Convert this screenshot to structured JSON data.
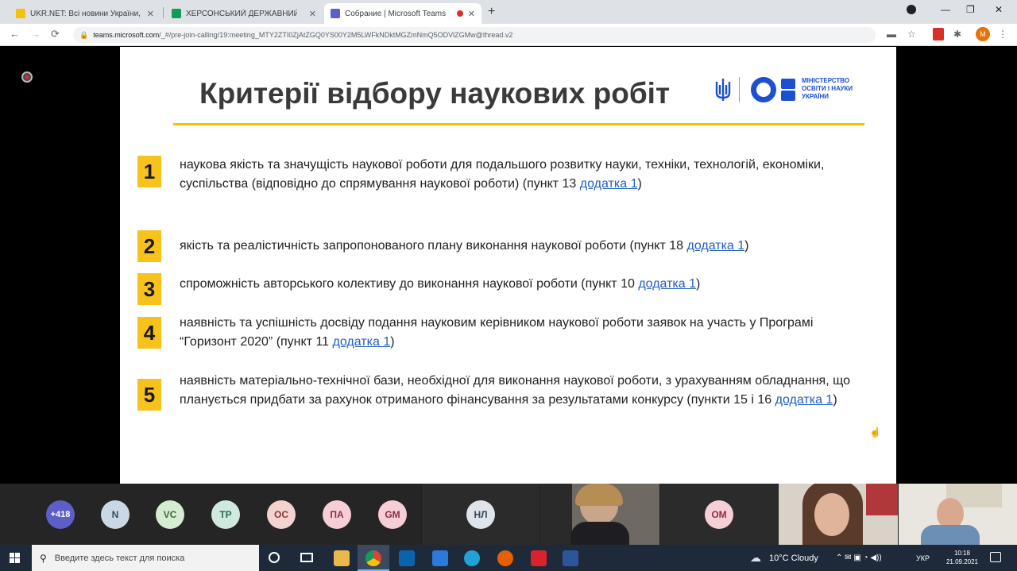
{
  "browser": {
    "tabs": [
      {
        "title": "UKR.NET: Всі новини України, о",
        "active": false,
        "favicon_color": "#f4c20d"
      },
      {
        "title": "ХЕРСОНСЬКИЙ ДЕРЖАВНИЙ А",
        "active": false,
        "favicon_color": "#0f9d58"
      },
      {
        "title": "Собрание | Microsoft Teams",
        "active": true,
        "favicon_color": "#5b5fc7"
      }
    ],
    "new_tab_label": "+",
    "url_host": "teams.microsoft.com",
    "url_path": "/_#/pre-join-calling/19:meeting_MTY2ZTI0ZjAtZGQ0YS00Y2M5LWFkNDktMGZmNmQ5ODVlZGMw@thread.v2",
    "profile_initial": "М"
  },
  "slide": {
    "title": "Критерії відбору наукових робіт",
    "ministry_logo_text": [
      "МІНІСТЕРСТВО",
      "ОСВІТИ І НАУКИ",
      "УКРАЇНИ"
    ],
    "accent_color": "#f2c400",
    "criteria": [
      {
        "num": "1",
        "text": "наукова якість та значущість наукової роботи для подальшого розвитку науки, техніки, технологій, економіки, суспільства (відповідно до спрямування наукової роботи) (пункт 13 ",
        "link": "додатка 1",
        "tail": ")"
      },
      {
        "num": "2",
        "text": "якість та реалістичність запропонованого плану виконання наукової роботи (пункт 18 ",
        "link": "додатка 1",
        "tail": ")"
      },
      {
        "num": "3",
        "text": "спроможність авторського колективу до виконання наукової роботи (пункт 10 ",
        "link": "додатка 1",
        "tail": ")"
      },
      {
        "num": "4",
        "text": "наявність та успішність досвіду подання науковим керівником наукової роботи заявок на участь у Програмі “Горизонт 2020” (пункт 11 ",
        "link": "додатка 1",
        "tail": ")"
      },
      {
        "num": "5",
        "text": "наявність матеріально-технічної бази, необхідної для виконання наукової роботи, з урахуванням обладнання, що планується придбати за рахунок отриманого фінансування за результатами конкурсу (пункти 15 і 16 ",
        "link": "додатка 1",
        "tail": ")"
      }
    ]
  },
  "participants": [
    {
      "initials": "+418",
      "bg": "#5b5fc7",
      "fg": "#ffffff"
    },
    {
      "initials": "N",
      "bg": "#c9d8e4",
      "fg": "#3a4a5a"
    },
    {
      "initials": "VC",
      "bg": "#d6ecd2",
      "fg": "#3c6b37"
    },
    {
      "initials": "TP",
      "bg": "#cfe9df",
      "fg": "#2e6b55"
    },
    {
      "initials": "OC",
      "bg": "#f2d3d0",
      "fg": "#8a3a33"
    },
    {
      "initials": "ПА",
      "bg": "#f6cfd6",
      "fg": "#8a2e45"
    },
    {
      "initials": "GM",
      "bg": "#f6cfd6",
      "fg": "#8a2e45"
    },
    {
      "initials": "НЛ",
      "bg": "#dfe3ea",
      "fg": "#3c4658"
    },
    {
      "initials": "OM",
      "bg": "#f6cfd6",
      "fg": "#8a2e45"
    }
  ],
  "taskbar": {
    "search_placeholder": "Введите здесь текст для поиска",
    "weather": "10°C Cloudy",
    "language": "УКР",
    "time": "10:18",
    "date": "21.09.2021"
  }
}
